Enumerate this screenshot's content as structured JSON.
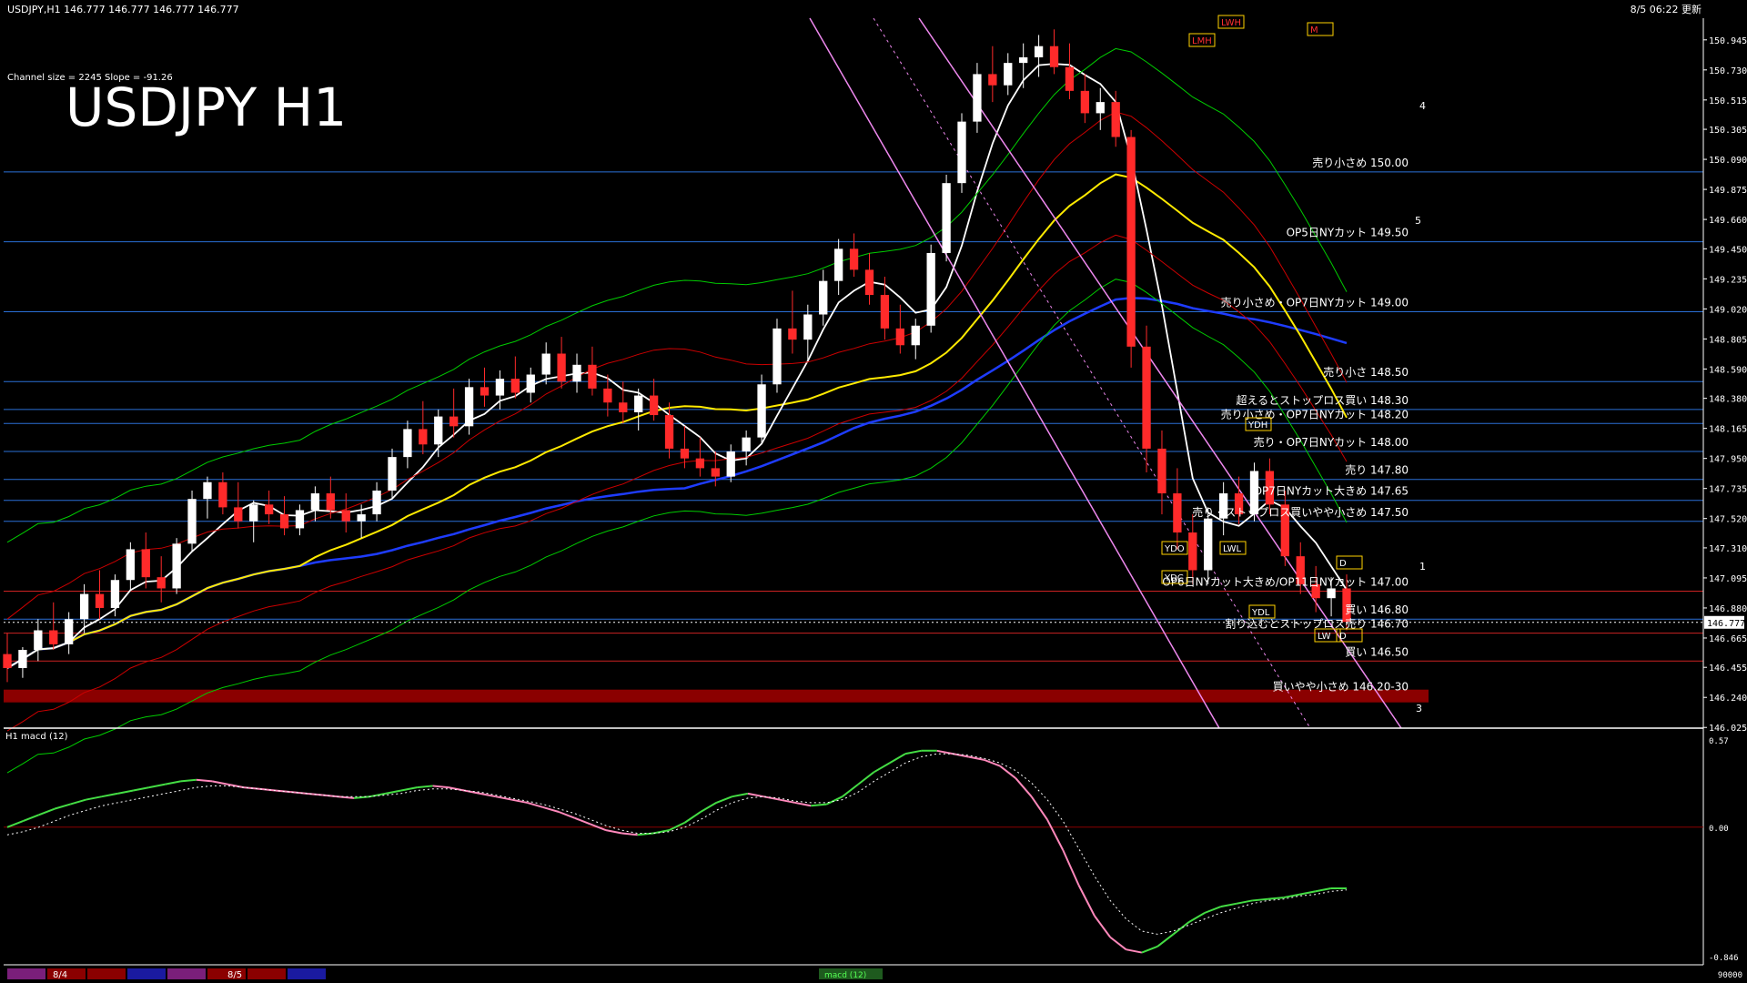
{
  "header": {
    "symbol_info": "USDJPY,H1  146.777 146.777 146.777 146.777",
    "updated": "8/5 06:22 更新",
    "channel_info": "Channel size = 2245 Slope = -91.26",
    "big_title": "USDJPY H1"
  },
  "colors": {
    "background": "#000000",
    "bull_candle": "#ffffff",
    "bear_candle": "#ff2a2a",
    "level_line": "#2a6fd6",
    "red_band": "#8b0000",
    "ma_fast": "#ffffff",
    "ma_mid": "#ffea00",
    "ma_slow": "#1e3cff",
    "bollinger": "#cc0000",
    "envelope": "#00cc00",
    "channel": "#ee88ee",
    "macd_up": "#44dd44",
    "macd_down": "#ff88bb"
  },
  "chart_data": {
    "type": "line",
    "title": "USDJPY H1",
    "y_axis_ticks": [
      "150.945",
      "150.730",
      "150.515",
      "150.305",
      "150.090",
      "149.875",
      "149.660",
      "149.450",
      "149.235",
      "149.020",
      "148.805",
      "148.590",
      "148.380",
      "148.165",
      "147.950",
      "147.735",
      "147.520",
      "147.310",
      "147.095",
      "146.880",
      "146.665",
      "146.455",
      "146.240",
      "146.025"
    ],
    "ylim": [
      146.02,
      151.1
    ],
    "current_price": "146.777",
    "levels": [
      {
        "price": 150.0,
        "label": "売り小さめ 150.00"
      },
      {
        "price": 149.5,
        "label": "OP5日NYカット 149.50"
      },
      {
        "price": 149.0,
        "label": "売り小さめ・OP7日NYカット 149.00"
      },
      {
        "price": 148.5,
        "label": "売り小さ 148.50"
      },
      {
        "price": 148.3,
        "label": "超えるとストップロス買い 148.30"
      },
      {
        "price": 148.2,
        "label": "売り小さめ・OP7日NYカット 148.20"
      },
      {
        "price": 148.0,
        "label": "売り・OP7日NYカット 148.00"
      },
      {
        "price": 147.8,
        "label": "売り 147.80"
      },
      {
        "price": 147.65,
        "label": "OP7日NYカット大きめ 147.65"
      },
      {
        "price": 147.5,
        "label": "売り・ストップロス買いやや小さめ 147.50"
      },
      {
        "price": 147.0,
        "label": "OP6日NYカット大きめ/OP11日NYカット 147.00"
      },
      {
        "price": 146.8,
        "label": "買い 146.80"
      },
      {
        "price": 146.7,
        "label": "割り込むとストップロス売り 146.70"
      },
      {
        "price": 146.5,
        "label": "買い 146.50"
      },
      {
        "price": 146.25,
        "label": "買いやや小さめ 146.20-30"
      }
    ],
    "candles": [
      {
        "o": 146.55,
        "h": 146.7,
        "l": 146.35,
        "c": 146.45
      },
      {
        "o": 146.45,
        "h": 146.6,
        "l": 146.38,
        "c": 146.58
      },
      {
        "o": 146.58,
        "h": 146.8,
        "l": 146.5,
        "c": 146.72
      },
      {
        "o": 146.72,
        "h": 146.92,
        "l": 146.58,
        "c": 146.62
      },
      {
        "o": 146.62,
        "h": 146.85,
        "l": 146.55,
        "c": 146.8
      },
      {
        "o": 146.8,
        "h": 147.05,
        "l": 146.7,
        "c": 146.98
      },
      {
        "o": 146.98,
        "h": 147.15,
        "l": 146.8,
        "c": 146.88
      },
      {
        "o": 146.88,
        "h": 147.12,
        "l": 146.82,
        "c": 147.08
      },
      {
        "o": 147.08,
        "h": 147.35,
        "l": 147.0,
        "c": 147.3
      },
      {
        "o": 147.3,
        "h": 147.42,
        "l": 147.02,
        "c": 147.1
      },
      {
        "o": 147.1,
        "h": 147.25,
        "l": 146.92,
        "c": 147.02
      },
      {
        "o": 147.02,
        "h": 147.38,
        "l": 146.98,
        "c": 147.34
      },
      {
        "o": 147.34,
        "h": 147.72,
        "l": 147.28,
        "c": 147.66
      },
      {
        "o": 147.66,
        "h": 147.82,
        "l": 147.52,
        "c": 147.78
      },
      {
        "o": 147.78,
        "h": 147.85,
        "l": 147.55,
        "c": 147.6
      },
      {
        "o": 147.6,
        "h": 147.78,
        "l": 147.45,
        "c": 147.5
      },
      {
        "o": 147.5,
        "h": 147.65,
        "l": 147.35,
        "c": 147.62
      },
      {
        "o": 147.62,
        "h": 147.72,
        "l": 147.48,
        "c": 147.55
      },
      {
        "o": 147.55,
        "h": 147.68,
        "l": 147.4,
        "c": 147.45
      },
      {
        "o": 147.45,
        "h": 147.62,
        "l": 147.4,
        "c": 147.58
      },
      {
        "o": 147.58,
        "h": 147.75,
        "l": 147.5,
        "c": 147.7
      },
      {
        "o": 147.7,
        "h": 147.82,
        "l": 147.52,
        "c": 147.58
      },
      {
        "o": 147.58,
        "h": 147.7,
        "l": 147.42,
        "c": 147.5
      },
      {
        "o": 147.5,
        "h": 147.62,
        "l": 147.38,
        "c": 147.55
      },
      {
        "o": 147.55,
        "h": 147.78,
        "l": 147.5,
        "c": 147.72
      },
      {
        "o": 147.72,
        "h": 148.02,
        "l": 147.66,
        "c": 147.96
      },
      {
        "o": 147.96,
        "h": 148.22,
        "l": 147.88,
        "c": 148.16
      },
      {
        "o": 148.16,
        "h": 148.36,
        "l": 147.98,
        "c": 148.05
      },
      {
        "o": 148.05,
        "h": 148.3,
        "l": 147.96,
        "c": 148.25
      },
      {
        "o": 148.25,
        "h": 148.45,
        "l": 148.1,
        "c": 148.18
      },
      {
        "o": 148.18,
        "h": 148.52,
        "l": 148.12,
        "c": 148.46
      },
      {
        "o": 148.46,
        "h": 148.6,
        "l": 148.32,
        "c": 148.4
      },
      {
        "o": 148.4,
        "h": 148.58,
        "l": 148.3,
        "c": 148.52
      },
      {
        "o": 148.52,
        "h": 148.68,
        "l": 148.38,
        "c": 148.42
      },
      {
        "o": 148.42,
        "h": 148.6,
        "l": 148.35,
        "c": 148.55
      },
      {
        "o": 148.55,
        "h": 148.78,
        "l": 148.48,
        "c": 148.7
      },
      {
        "o": 148.7,
        "h": 148.82,
        "l": 148.45,
        "c": 148.5
      },
      {
        "o": 148.5,
        "h": 148.7,
        "l": 148.42,
        "c": 148.62
      },
      {
        "o": 148.62,
        "h": 148.75,
        "l": 148.4,
        "c": 148.45
      },
      {
        "o": 148.45,
        "h": 148.55,
        "l": 148.25,
        "c": 148.35
      },
      {
        "o": 148.35,
        "h": 148.5,
        "l": 148.2,
        "c": 148.28
      },
      {
        "o": 148.28,
        "h": 148.45,
        "l": 148.15,
        "c": 148.4
      },
      {
        "o": 148.4,
        "h": 148.52,
        "l": 148.22,
        "c": 148.26
      },
      {
        "o": 148.26,
        "h": 148.35,
        "l": 147.95,
        "c": 148.02
      },
      {
        "o": 148.02,
        "h": 148.18,
        "l": 147.88,
        "c": 147.95
      },
      {
        "o": 147.95,
        "h": 148.1,
        "l": 147.82,
        "c": 147.88
      },
      {
        "o": 147.88,
        "h": 148.0,
        "l": 147.75,
        "c": 147.82
      },
      {
        "o": 147.82,
        "h": 148.05,
        "l": 147.78,
        "c": 148.0
      },
      {
        "o": 148.0,
        "h": 148.15,
        "l": 147.9,
        "c": 148.1
      },
      {
        "o": 148.1,
        "h": 148.55,
        "l": 148.05,
        "c": 148.48
      },
      {
        "o": 148.48,
        "h": 148.95,
        "l": 148.42,
        "c": 148.88
      },
      {
        "o": 148.88,
        "h": 149.15,
        "l": 148.7,
        "c": 148.8
      },
      {
        "o": 148.8,
        "h": 149.05,
        "l": 148.65,
        "c": 148.98
      },
      {
        "o": 148.98,
        "h": 149.3,
        "l": 148.9,
        "c": 149.22
      },
      {
        "o": 149.22,
        "h": 149.52,
        "l": 149.12,
        "c": 149.45
      },
      {
        "o": 149.45,
        "h": 149.56,
        "l": 149.25,
        "c": 149.3
      },
      {
        "o": 149.3,
        "h": 149.42,
        "l": 149.05,
        "c": 149.12
      },
      {
        "o": 149.12,
        "h": 149.25,
        "l": 148.8,
        "c": 148.88
      },
      {
        "o": 148.88,
        "h": 149.05,
        "l": 148.7,
        "c": 148.76
      },
      {
        "o": 148.76,
        "h": 148.95,
        "l": 148.66,
        "c": 148.9
      },
      {
        "o": 148.9,
        "h": 149.48,
        "l": 148.85,
        "c": 149.42
      },
      {
        "o": 149.42,
        "h": 149.98,
        "l": 149.36,
        "c": 149.92
      },
      {
        "o": 149.92,
        "h": 150.42,
        "l": 149.85,
        "c": 150.36
      },
      {
        "o": 150.36,
        "h": 150.78,
        "l": 150.28,
        "c": 150.7
      },
      {
        "o": 150.7,
        "h": 150.9,
        "l": 150.5,
        "c": 150.62
      },
      {
        "o": 150.62,
        "h": 150.85,
        "l": 150.55,
        "c": 150.78
      },
      {
        "o": 150.78,
        "h": 150.92,
        "l": 150.6,
        "c": 150.82
      },
      {
        "o": 150.82,
        "h": 150.98,
        "l": 150.68,
        "c": 150.9
      },
      {
        "o": 150.9,
        "h": 151.02,
        "l": 150.7,
        "c": 150.75
      },
      {
        "o": 150.75,
        "h": 150.92,
        "l": 150.52,
        "c": 150.58
      },
      {
        "o": 150.58,
        "h": 150.7,
        "l": 150.35,
        "c": 150.42
      },
      {
        "o": 150.42,
        "h": 150.6,
        "l": 150.3,
        "c": 150.5
      },
      {
        "o": 150.5,
        "h": 150.58,
        "l": 150.18,
        "c": 150.25
      },
      {
        "o": 150.25,
        "h": 150.3,
        "l": 148.6,
        "c": 148.75
      },
      {
        "o": 148.75,
        "h": 148.9,
        "l": 147.85,
        "c": 148.02
      },
      {
        "o": 148.02,
        "h": 148.15,
        "l": 147.55,
        "c": 147.7
      },
      {
        "o": 147.7,
        "h": 147.88,
        "l": 147.3,
        "c": 147.42
      },
      {
        "o": 147.42,
        "h": 147.55,
        "l": 147.05,
        "c": 147.15
      },
      {
        "o": 147.15,
        "h": 147.6,
        "l": 147.05,
        "c": 147.52
      },
      {
        "o": 147.52,
        "h": 147.78,
        "l": 147.4,
        "c": 147.7
      },
      {
        "o": 147.7,
        "h": 147.82,
        "l": 147.48,
        "c": 147.55
      },
      {
        "o": 147.55,
        "h": 147.92,
        "l": 147.5,
        "c": 147.86
      },
      {
        "o": 147.86,
        "h": 147.95,
        "l": 147.55,
        "c": 147.62
      },
      {
        "o": 147.62,
        "h": 147.72,
        "l": 147.18,
        "c": 147.25
      },
      {
        "o": 147.25,
        "h": 147.35,
        "l": 146.98,
        "c": 147.05
      },
      {
        "o": 147.05,
        "h": 147.18,
        "l": 146.85,
        "c": 146.95
      },
      {
        "o": 146.95,
        "h": 147.1,
        "l": 146.82,
        "c": 147.02
      },
      {
        "o": 147.02,
        "h": 147.12,
        "l": 146.72,
        "c": 146.78
      }
    ],
    "macd": [
      0.0,
      0.04,
      0.08,
      0.12,
      0.15,
      0.18,
      0.2,
      0.22,
      0.24,
      0.26,
      0.28,
      0.3,
      0.31,
      0.3,
      0.28,
      0.26,
      0.25,
      0.24,
      0.23,
      0.22,
      0.21,
      0.2,
      0.19,
      0.2,
      0.22,
      0.24,
      0.26,
      0.27,
      0.26,
      0.24,
      0.22,
      0.2,
      0.18,
      0.16,
      0.13,
      0.1,
      0.06,
      0.02,
      -0.02,
      -0.04,
      -0.05,
      -0.04,
      -0.02,
      0.03,
      0.1,
      0.16,
      0.2,
      0.22,
      0.2,
      0.18,
      0.16,
      0.14,
      0.15,
      0.2,
      0.28,
      0.36,
      0.42,
      0.48,
      0.5,
      0.5,
      0.48,
      0.46,
      0.44,
      0.4,
      0.32,
      0.2,
      0.05,
      -0.15,
      -0.38,
      -0.58,
      -0.72,
      -0.8,
      -0.82,
      -0.78,
      -0.7,
      -0.62,
      -0.56,
      -0.52,
      -0.5,
      -0.48,
      -0.47,
      -0.46,
      -0.44,
      -0.42,
      -0.4,
      -0.4
    ],
    "macd_signal": [
      -0.05,
      -0.03,
      0.0,
      0.04,
      0.08,
      0.11,
      0.14,
      0.16,
      0.18,
      0.2,
      0.22,
      0.24,
      0.26,
      0.27,
      0.27,
      0.26,
      0.25,
      0.24,
      0.23,
      0.22,
      0.21,
      0.2,
      0.2,
      0.2,
      0.21,
      0.22,
      0.24,
      0.25,
      0.25,
      0.24,
      0.23,
      0.21,
      0.19,
      0.17,
      0.15,
      0.12,
      0.09,
      0.05,
      0.01,
      -0.02,
      -0.04,
      -0.04,
      -0.03,
      0.0,
      0.05,
      0.11,
      0.16,
      0.19,
      0.2,
      0.19,
      0.17,
      0.16,
      0.16,
      0.18,
      0.23,
      0.3,
      0.36,
      0.42,
      0.46,
      0.48,
      0.48,
      0.47,
      0.45,
      0.42,
      0.37,
      0.29,
      0.18,
      0.04,
      -0.14,
      -0.32,
      -0.48,
      -0.6,
      -0.68,
      -0.7,
      -0.68,
      -0.64,
      -0.6,
      -0.56,
      -0.53,
      -0.5,
      -0.48,
      -0.47,
      -0.45,
      -0.44,
      -0.42,
      -0.41
    ]
  },
  "macd_panel": {
    "label": "H1 macd (12)",
    "ticks": [
      "0.57",
      "0.00",
      "-0.846"
    ],
    "ylim": [
      -0.9,
      0.6
    ]
  },
  "markers": {
    "lines_right": [
      "4",
      "5",
      "1",
      "3"
    ],
    "boxes": [
      "LWH",
      "LMH",
      "M",
      "YDO",
      "YDC",
      "YDH",
      "YDL",
      "LWL",
      "LW",
      "D",
      "D"
    ]
  },
  "bottom_bar": {
    "dates": [
      "8/4",
      "8/5"
    ],
    "center_label": "macd (12)",
    "right_value": "90000"
  }
}
